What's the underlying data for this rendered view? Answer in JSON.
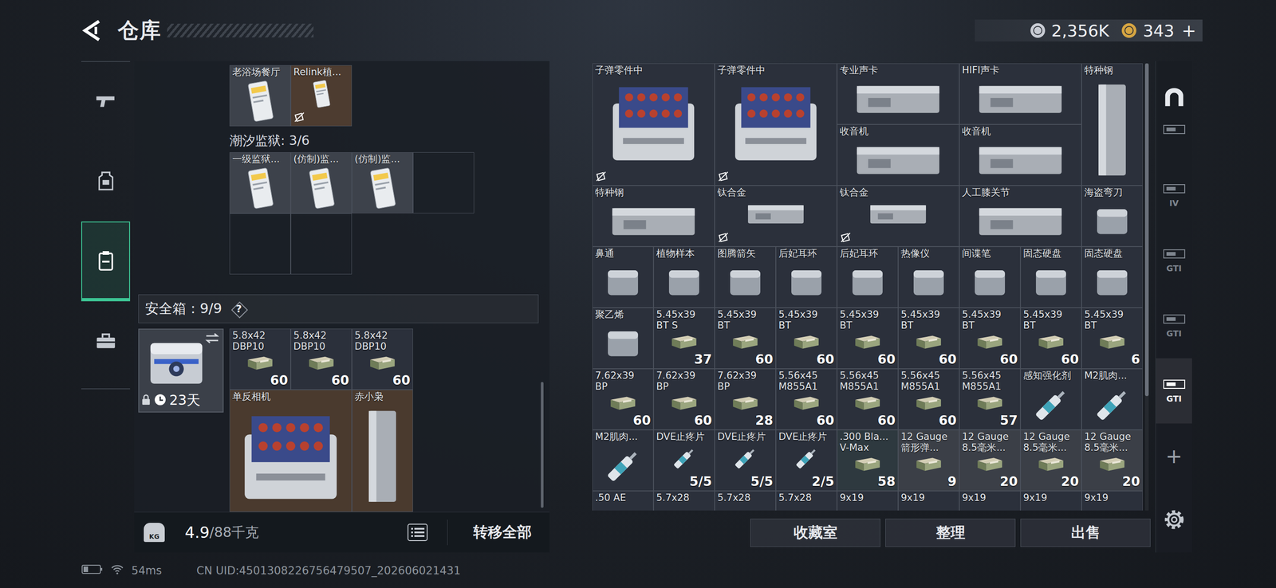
{
  "header": {
    "title": "仓库"
  },
  "currency": [
    {
      "value": "2,356K",
      "color": "#c8ccd4"
    },
    {
      "value": "343",
      "color": "#d6a542"
    }
  ],
  "currency_add": "+",
  "nav": [
    {
      "selected": false
    },
    {
      "selected": false
    },
    {
      "selected": true
    },
    {
      "selected": false
    }
  ],
  "containers": [
    {
      "slots": [
        {
          "name": "老浴场餐厅",
          "kind": "card",
          "color": "#3d424b"
        },
        {
          "name": "Relink植...",
          "kind": "card",
          "color": "#4d3c30",
          "locked": true
        }
      ]
    },
    {
      "title": "潮汐监狱: 3/6",
      "slots": [
        {
          "name": "一级监狱...",
          "kind": "card",
          "color": "#3d424b"
        },
        {
          "name": "(仿制)监...",
          "kind": "card",
          "color": "#3d424b"
        },
        {
          "name": "(仿制)监...",
          "kind": "card",
          "color": "#3d424b"
        },
        {
          "kind": "empty"
        },
        {
          "kind": "empty"
        },
        {
          "kind": "empty"
        }
      ]
    }
  ],
  "safe": {
    "title": "安全箱：9/9",
    "help": "?",
    "locked": true,
    "days": "23天",
    "items": [
      {
        "name": "5.8x42\nDBP10",
        "kind": "ammo",
        "count": "60",
        "color": "#2b303b"
      },
      {
        "name": "5.8x42\nDBP10",
        "kind": "ammo",
        "count": "60",
        "color": "#2b303b"
      },
      {
        "name": "5.8x42\nDBP10",
        "kind": "ammo",
        "count": "60",
        "color": "#2b303b"
      },
      {
        "name": "单反相机",
        "kind": "big",
        "color": "#4a3a2e"
      },
      {
        "name": "赤小枭",
        "kind": "tall",
        "color": "#4a3a2e"
      }
    ]
  },
  "weight": {
    "icon": "KG",
    "current": "4.9",
    "max": "/88千克"
  },
  "transfer_button": "转移全部",
  "stash": {
    "items": [
      {
        "name": "子弹零件中",
        "kind": "big",
        "color": "#2b303b",
        "locked": true
      },
      {
        "name": "子弹零件中",
        "kind": "big",
        "color": "#2b303b",
        "locked": true
      },
      {
        "name": "专业声卡",
        "kind": "wide",
        "color": "#2b303b"
      },
      {
        "name": "HIFI声卡",
        "kind": "wide",
        "color": "#2b303b"
      },
      {
        "name": "特种钢",
        "kind": "tall",
        "color": "#2b303b"
      },
      {
        "name": "收音机",
        "kind": "wide",
        "color": "#2b303b"
      },
      {
        "name": "收音机",
        "kind": "wide",
        "color": "#2b303b"
      },
      {
        "name": "特种钢",
        "kind": "wide",
        "color": "#2b303b"
      },
      {
        "name": "钛合金",
        "kind": "wide",
        "color": "#2b303b",
        "locked": true
      },
      {
        "name": "钛合金",
        "kind": "wide",
        "color": "#2b303b",
        "locked": true
      },
      {
        "name": "人工膝关节",
        "kind": "wide",
        "color": "#2b303b"
      },
      {
        "name": "海盗弯刀",
        "kind": "item",
        "color": "#2b303b"
      },
      {
        "name": "鼻通",
        "kind": "item",
        "color": "#2b303b"
      },
      {
        "name": "植物样本",
        "kind": "item",
        "color": "#2b303b"
      },
      {
        "name": "图腾箭矢",
        "kind": "item",
        "color": "#2b303b"
      },
      {
        "name": "后妃耳环",
        "kind": "item",
        "color": "#2b303b"
      },
      {
        "name": "后妃耳环",
        "kind": "item",
        "color": "#2b303b"
      },
      {
        "name": "热像仪",
        "kind": "item",
        "color": "#2b303b"
      },
      {
        "name": "间谍笔",
        "kind": "item",
        "color": "#2b303b"
      },
      {
        "name": "固态硬盘",
        "kind": "item",
        "color": "#2b303b"
      },
      {
        "name": "固态硬盘",
        "kind": "item",
        "color": "#2b303b"
      },
      {
        "name": "聚乙烯",
        "kind": "item",
        "color": "#2b303b"
      },
      {
        "name": "5.45x39\nBT S",
        "kind": "ammo",
        "count": "37",
        "color": "#2b303b"
      },
      {
        "name": "5.45x39\nBT",
        "kind": "ammo",
        "count": "60",
        "color": "#2b303b"
      },
      {
        "name": "5.45x39\nBT",
        "kind": "ammo",
        "count": "60",
        "color": "#2b303b"
      },
      {
        "name": "5.45x39\nBT",
        "kind": "ammo",
        "count": "60",
        "color": "#2b303b"
      },
      {
        "name": "5.45x39\nBT",
        "kind": "ammo",
        "count": "60",
        "color": "#2b303b"
      },
      {
        "name": "5.45x39\nBT",
        "kind": "ammo",
        "count": "60",
        "color": "#2b303b"
      },
      {
        "name": "5.45x39\nBT",
        "kind": "ammo",
        "count": "60",
        "color": "#2b303b"
      },
      {
        "name": "5.45x39\nBT",
        "kind": "ammo",
        "count": "6",
        "color": "#2b303b"
      },
      {
        "name": "7.62x39\nBP",
        "kind": "ammo",
        "count": "60",
        "color": "#2b303b"
      },
      {
        "name": "7.62x39\nBP",
        "kind": "ammo",
        "count": "60",
        "color": "#2b303b"
      },
      {
        "name": "7.62x39\nBP",
        "kind": "ammo",
        "count": "28",
        "color": "#2b303b"
      },
      {
        "name": "5.56x45\nM855A1",
        "kind": "ammo",
        "count": "60",
        "color": "#2b303b"
      },
      {
        "name": "5.56x45\nM855A1",
        "kind": "ammo",
        "count": "60",
        "color": "#2b303b"
      },
      {
        "name": "5.56x45\nM855A1",
        "kind": "ammo",
        "count": "60",
        "color": "#2b303b"
      },
      {
        "name": "5.56x45\nM855A1",
        "kind": "ammo",
        "count": "57",
        "color": "#2b303b"
      },
      {
        "name": "感知强化剂",
        "kind": "med",
        "color": "#2b303b"
      },
      {
        "name": "M2肌肉...",
        "kind": "med",
        "color": "#2b303b"
      },
      {
        "name": "M2肌肉...",
        "kind": "med",
        "color": "#2b303b"
      },
      {
        "name": "DVE止疼片",
        "kind": "med",
        "count": "5/5",
        "color": "#2b303b"
      },
      {
        "name": "DVE止疼片",
        "kind": "med",
        "count": "5/5",
        "color": "#2b303b"
      },
      {
        "name": "DVE止疼片",
        "kind": "med",
        "count": "2/5",
        "color": "#2b303b"
      },
      {
        "name": ".300 Bla...\nV-Max",
        "kind": "ammo",
        "count": "58",
        "color": "#2e393f"
      },
      {
        "name": "12 Gauge\n箭形弹...",
        "kind": "ammo",
        "count": "9",
        "color": "#3b3f47"
      },
      {
        "name": "12 Gauge\n8.5毫米...",
        "kind": "ammo",
        "count": "20",
        "color": "#3b3f47"
      },
      {
        "name": "12 Gauge\n8.5毫米...",
        "kind": "ammo",
        "count": "20",
        "color": "#3b3f47"
      },
      {
        "name": "12 Gauge\n8.5毫米...",
        "kind": "ammo",
        "count": "20",
        "color": "#3b3f47"
      },
      {
        "name": ".50 AE",
        "kind": "ammo",
        "color": "#2b303b"
      },
      {
        "name": "5.7x28",
        "kind": "ammo",
        "color": "#2b303b"
      },
      {
        "name": "5.7x28",
        "kind": "ammo",
        "color": "#2b303b"
      },
      {
        "name": "5.7x28",
        "kind": "ammo",
        "color": "#2b303b"
      },
      {
        "name": "9x19",
        "kind": "ammo",
        "color": "#2b303b"
      },
      {
        "name": "9x19",
        "kind": "ammo",
        "color": "#2b303b"
      },
      {
        "name": "9x19",
        "kind": "ammo",
        "color": "#2b303b"
      },
      {
        "name": "9x19",
        "kind": "ammo",
        "color": "#2b303b"
      },
      {
        "name": "9x19",
        "kind": "ammo",
        "color": "#2b303b"
      }
    ]
  },
  "buttons": [
    "收藏室",
    "整理",
    "出售"
  ],
  "side_tabs": [
    {
      "selected": false
    },
    {
      "label": "IV",
      "selected": false
    },
    {
      "label": "GTI",
      "selected": false
    },
    {
      "label": "GTI",
      "selected": false
    },
    {
      "label": "GTI",
      "selected": true
    }
  ],
  "side_add": "+",
  "status": {
    "ping": "54ms",
    "uid": "CN UID:4501308226756479507_202606021431"
  }
}
